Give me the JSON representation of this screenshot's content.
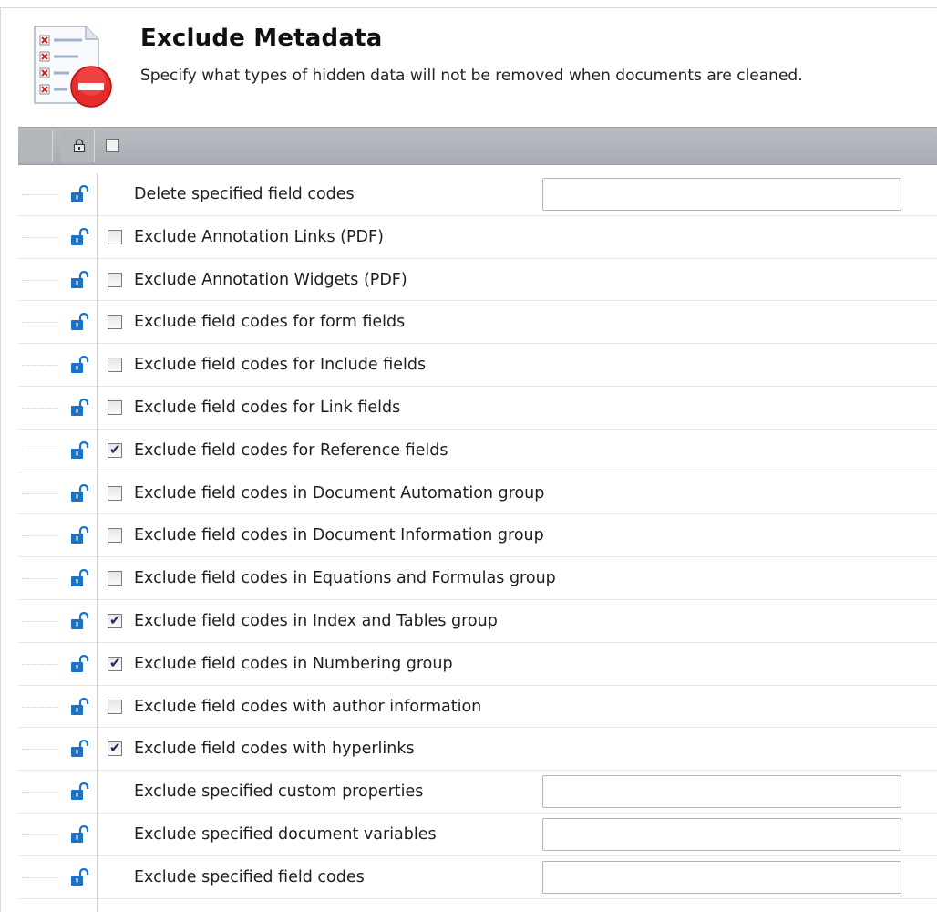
{
  "header": {
    "title": "Exclude Metadata",
    "subtitle": "Specify what types of hidden data will not be removed when documents are cleaned.",
    "icon": "metadata-list-remove-icon"
  },
  "grid_header": {
    "lock_icon": "lock-icon",
    "select_all_checked": false
  },
  "rows": [
    {
      "label": "Delete specified field codes",
      "control": "text",
      "value": ""
    },
    {
      "label": "Exclude Annotation Links (PDF)",
      "control": "checkbox",
      "checked": false
    },
    {
      "label": "Exclude Annotation Widgets (PDF)",
      "control": "checkbox",
      "checked": false
    },
    {
      "label": "Exclude field codes for form fields",
      "control": "checkbox",
      "checked": false
    },
    {
      "label": "Exclude field codes for Include fields",
      "control": "checkbox",
      "checked": false
    },
    {
      "label": "Exclude field codes for Link fields",
      "control": "checkbox",
      "checked": false
    },
    {
      "label": "Exclude field codes for Reference fields",
      "control": "checkbox",
      "checked": true
    },
    {
      "label": "Exclude field codes in Document Automation group",
      "control": "checkbox",
      "checked": false
    },
    {
      "label": "Exclude field codes in Document Information group",
      "control": "checkbox",
      "checked": false
    },
    {
      "label": "Exclude field codes in Equations and Formulas group",
      "control": "checkbox",
      "checked": false
    },
    {
      "label": "Exclude field codes in Index and Tables group",
      "control": "checkbox",
      "checked": true
    },
    {
      "label": "Exclude field codes in Numbering group",
      "control": "checkbox",
      "checked": true
    },
    {
      "label": "Exclude field codes with author information",
      "control": "checkbox",
      "checked": false
    },
    {
      "label": "Exclude field codes with hyperlinks",
      "control": "checkbox",
      "checked": true
    },
    {
      "label": "Exclude specified custom properties",
      "control": "text",
      "value": ""
    },
    {
      "label": "Exclude specified document variables",
      "control": "text",
      "value": ""
    },
    {
      "label": "Exclude specified field codes",
      "control": "text",
      "value": ""
    }
  ],
  "colors": {
    "lock_blue": "#1a73c8",
    "header_bar": "#b0b4ba",
    "remove_red": "#e02020"
  }
}
